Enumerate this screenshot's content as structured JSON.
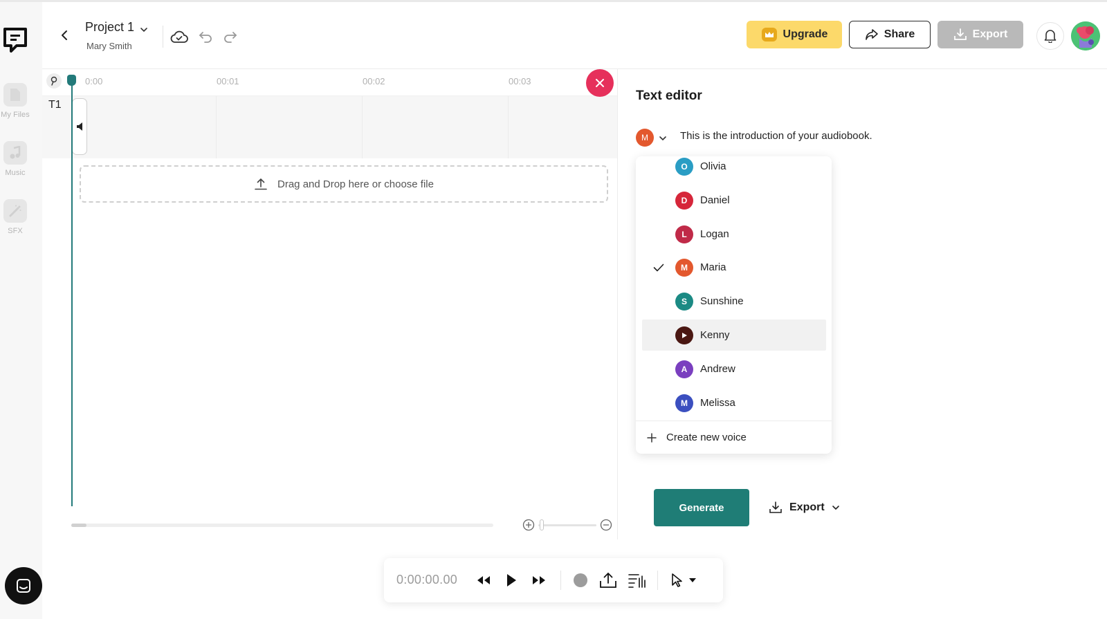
{
  "header": {
    "project_title": "Project 1",
    "project_owner": "Mary Smith",
    "upgrade_label": "Upgrade",
    "share_label": "Share",
    "export_label": "Export"
  },
  "sidebar": {
    "items": [
      {
        "label": "My Files",
        "icon": "file-icon"
      },
      {
        "label": "Music",
        "icon": "music-note-icon"
      },
      {
        "label": "SFX",
        "icon": "magic-wand-icon"
      }
    ]
  },
  "timeline": {
    "ticks": [
      "0:00",
      "00:01",
      "00:02",
      "00:03"
    ],
    "track_label": "T1",
    "dropzone_label": "Drag and Drop here or choose file",
    "playhead_color": "#237a7a"
  },
  "editor": {
    "title": "Text editor",
    "selected_voice_initial": "M",
    "text": "This is the introduction of your audiobook.",
    "voices": [
      {
        "initial": "O",
        "name": "Olivia",
        "color": "#2a9dc4",
        "selected": false
      },
      {
        "initial": "D",
        "name": "Daniel",
        "color": "#d6263a",
        "selected": false
      },
      {
        "initial": "L",
        "name": "Logan",
        "color": "#c02a48",
        "selected": false
      },
      {
        "initial": "M",
        "name": "Maria",
        "color": "#e3582e",
        "selected": true
      },
      {
        "initial": "S",
        "name": "Sunshine",
        "color": "#1b8a84",
        "selected": false
      },
      {
        "initial": "",
        "name": "Kenny",
        "color": "#4a1712",
        "selected": false,
        "playing": true
      },
      {
        "initial": "A",
        "name": "Andrew",
        "color": "#7a3fbf",
        "selected": false
      },
      {
        "initial": "M",
        "name": "Melissa",
        "color": "#3b4fbf",
        "selected": false
      }
    ],
    "create_voice_label": "Create new voice",
    "generate_label": "Generate",
    "export_label": "Export"
  },
  "transport": {
    "time": "0:00:00.00"
  },
  "colors": {
    "accent": "#1f7d76",
    "upgrade": "#fcd96a",
    "close": "#e6305b"
  }
}
